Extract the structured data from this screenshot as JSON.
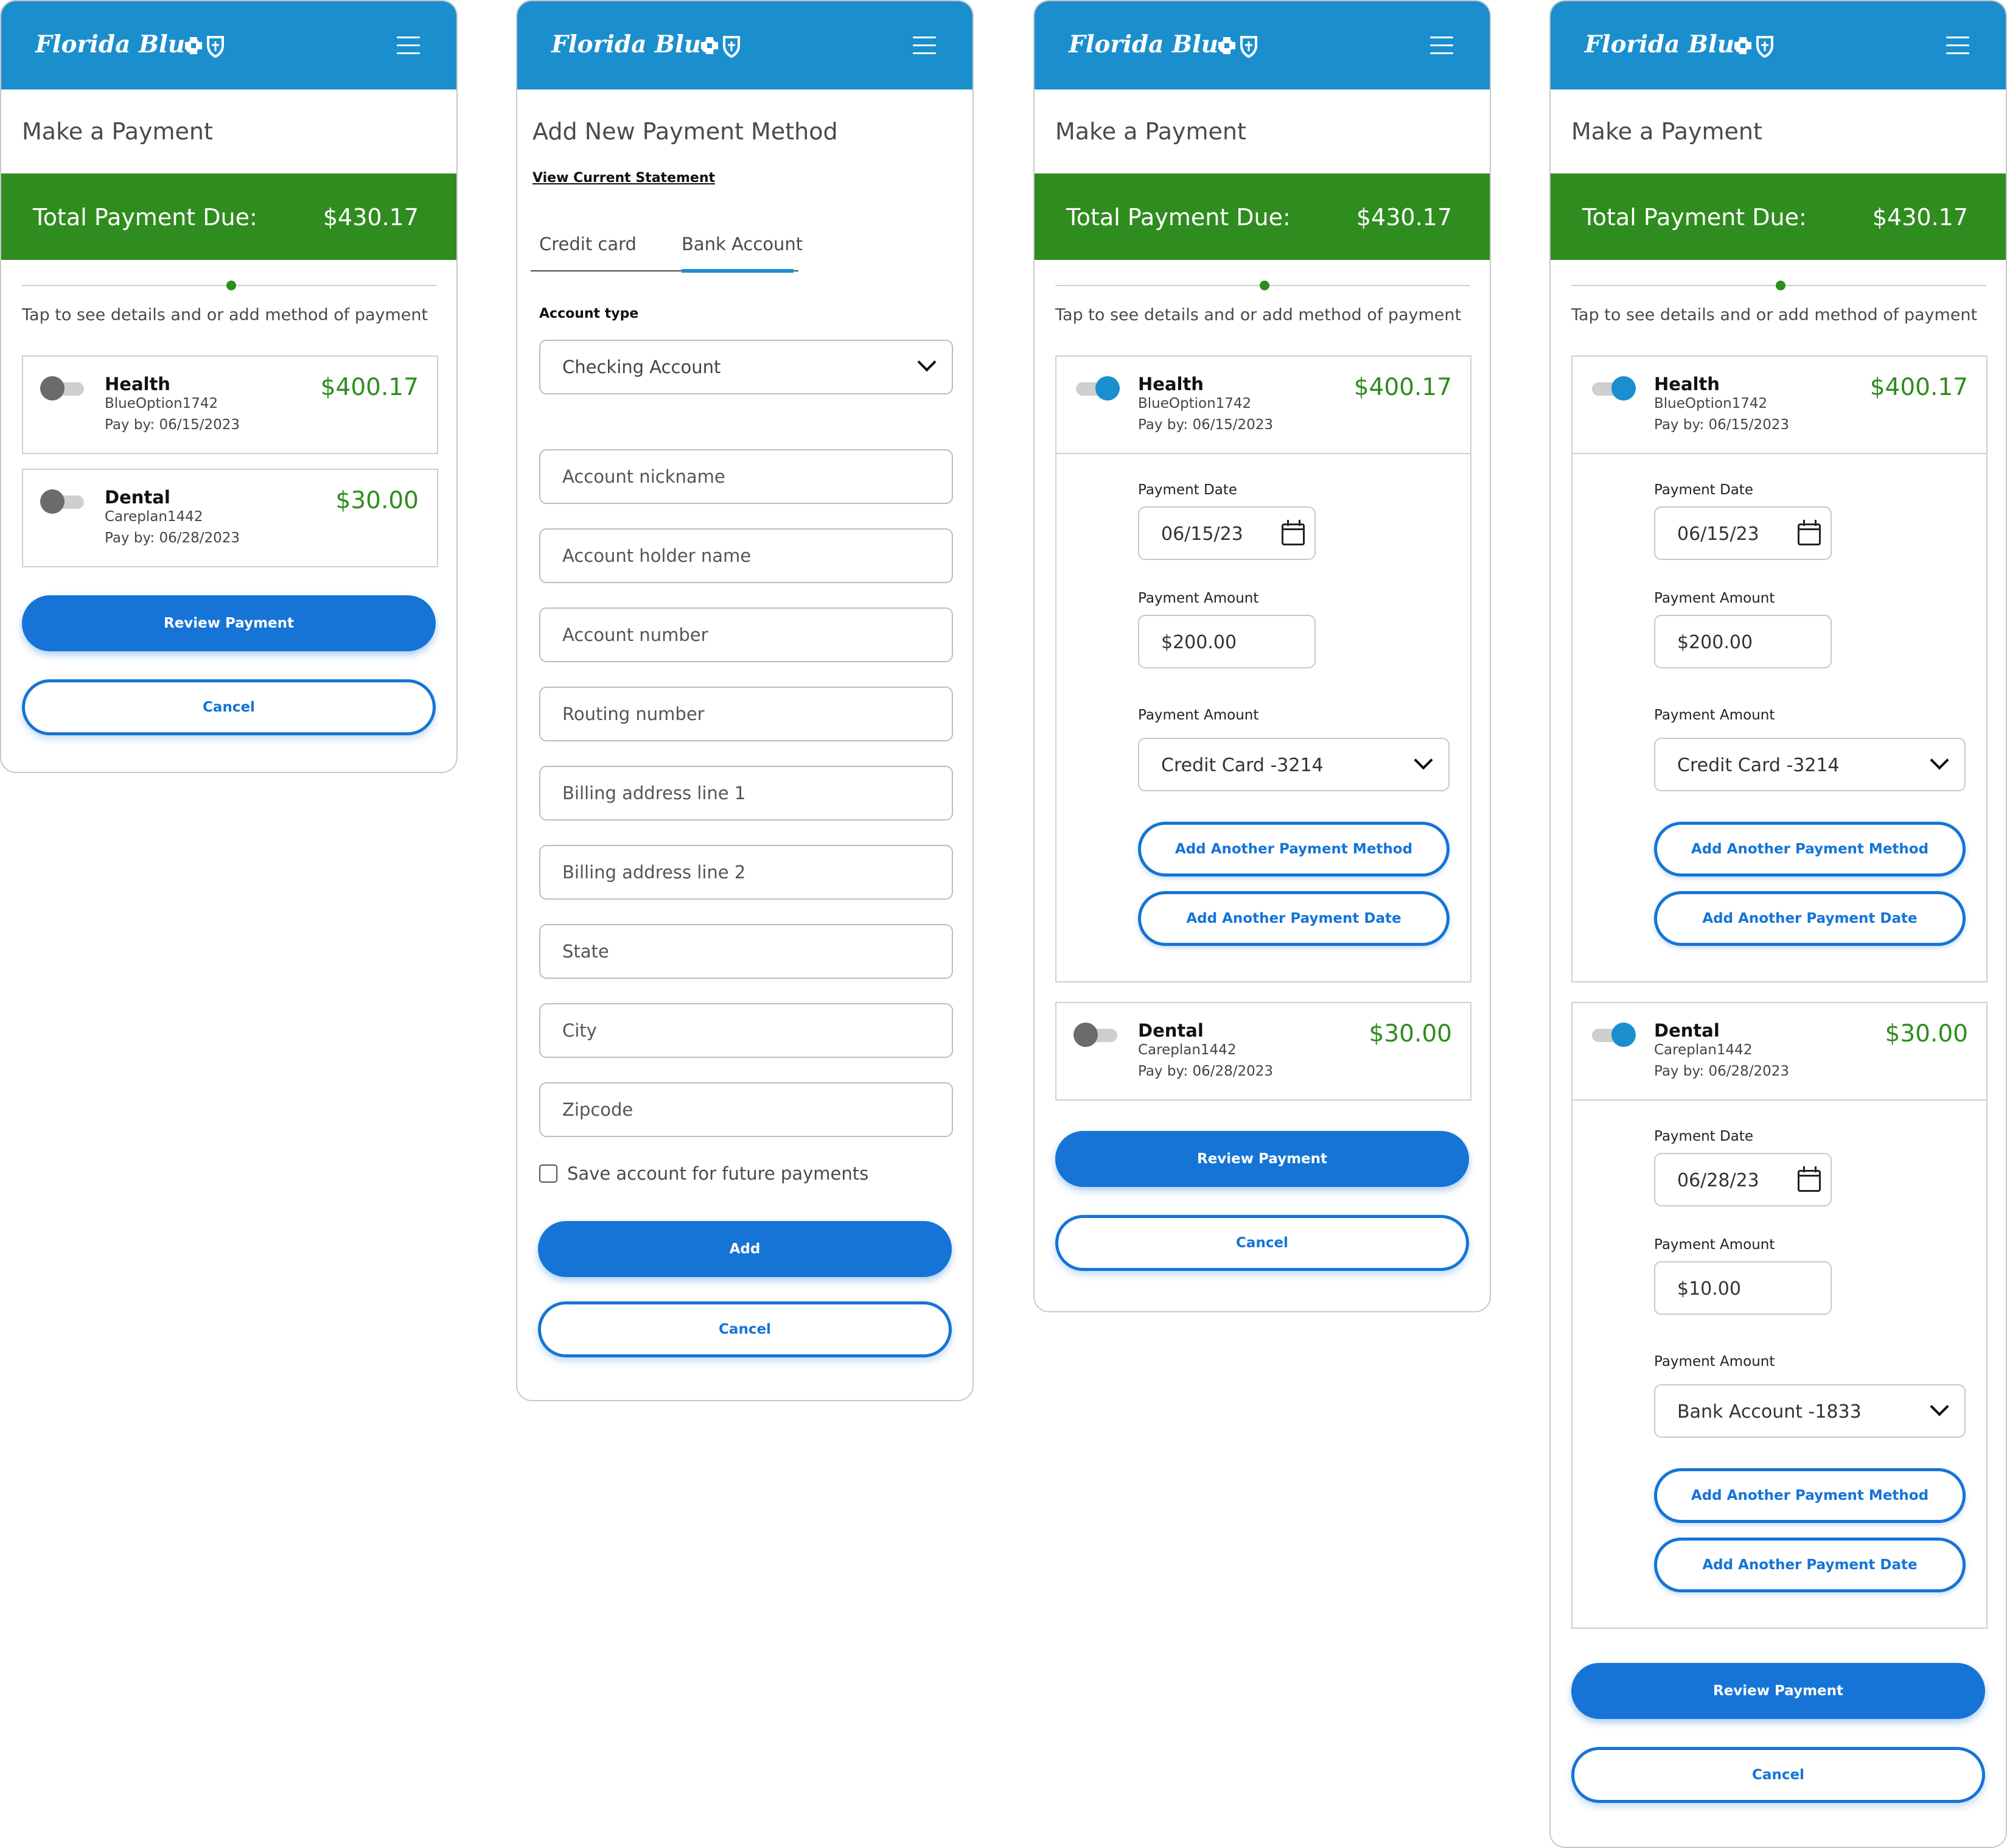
{
  "brand": {
    "name": "Florida Blue",
    "primary_color": "#1b8fcd",
    "action_color": "#1574d6",
    "success_color": "#2f8c1e"
  },
  "header": {
    "menu_icon": "hamburger-menu-icon",
    "logo_icon": "cross-shield-logo-icon"
  },
  "make_payment": {
    "title": "Make a Payment",
    "total_label": "Total Payment Due:",
    "total_amount": "$430.17",
    "instruction": "Tap to see details and or add method of payment",
    "plans": {
      "health": {
        "name": "Health",
        "plan_id": "BlueOption1742",
        "pay_by": "Pay by: 06/15/2023",
        "amount": "$400.17"
      },
      "dental": {
        "name": "Dental",
        "plan_id": "Careplan1442",
        "pay_by": "Pay by: 06/28/2023",
        "amount": "$30.00"
      }
    },
    "form_labels": {
      "payment_date": "Payment Date",
      "payment_amount": "Payment Amount",
      "payment_method": "Payment Amount"
    },
    "health_payment": {
      "date": "06/15/23",
      "amount": "$200.00",
      "method": "Credit Card -3214"
    },
    "dental_payment": {
      "date": "06/28/23",
      "amount": "$10.00",
      "method": "Bank Account -1833"
    },
    "add_method_label": "Add Another Payment Method",
    "add_date_label": "Add Another Payment Date",
    "review_label": "Review Payment",
    "cancel_label": "Cancel"
  },
  "add_method": {
    "title": "Add New Payment Method",
    "statement_link": "View Current Statement",
    "tabs": [
      {
        "label": "Credit card",
        "active": false
      },
      {
        "label": "Bank Account",
        "active": true
      }
    ],
    "account_type_label": "Account type",
    "account_type_value": "Checking Account",
    "fields": {
      "nickname": "Account nickname",
      "holder": "Account holder name",
      "number": "Account number",
      "routing": "Routing number",
      "address1": "Billing address line 1",
      "address2": "Billing address line 2",
      "state": "State",
      "city": "City",
      "zipcode": "Zipcode"
    },
    "save_checkbox_label": "Save account for future payments",
    "save_checked": false,
    "add_label": "Add",
    "cancel_label": "Cancel"
  }
}
